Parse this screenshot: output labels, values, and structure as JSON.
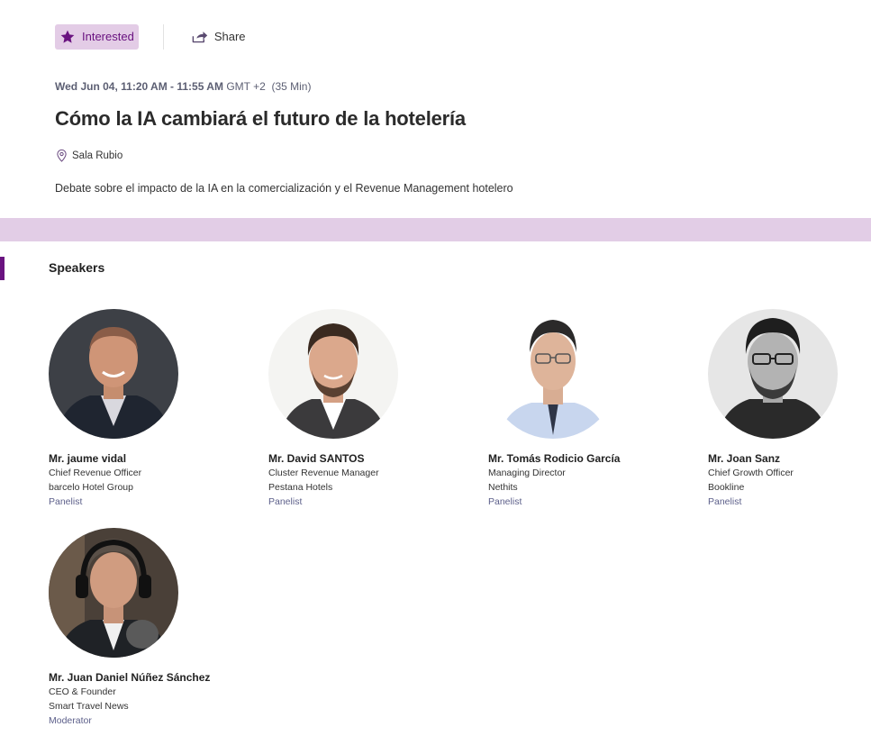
{
  "actions": {
    "interested_label": "Interested",
    "share_label": "Share"
  },
  "session": {
    "datetime": "Wed Jun 04, 11:20 AM - 11:55 AM",
    "timezone": "GMT +2",
    "duration": "(35 Min)",
    "title": "Cómo la IA cambiará el futuro de la hotelería",
    "location": "Sala Rubio",
    "description": "Debate sobre el impacto de la IA en la comercialización y el Revenue Management hotelero"
  },
  "speakers_section": {
    "heading": "Speakers",
    "speakers": [
      {
        "name": "Mr. jaume vidal",
        "title": "Chief Revenue Officer",
        "company": "barcelo Hotel Group",
        "role": "Panelist"
      },
      {
        "name": "Mr. David SANTOS",
        "title": "Cluster Revenue Manager",
        "company": "Pestana Hotels",
        "role": "Panelist"
      },
      {
        "name": "Mr. Tomás Rodicio García",
        "title": "Managing Director",
        "company": "Nethits",
        "role": "Panelist"
      },
      {
        "name": "Mr. Joan Sanz",
        "title": "Chief Growth Officer",
        "company": "Bookline",
        "role": "Panelist"
      },
      {
        "name": "Mr. Juan Daniel Núñez Sánchez",
        "title": "CEO & Founder",
        "company": "Smart Travel News",
        "role": "Moderator"
      }
    ]
  },
  "colors": {
    "accent": "#6a1380",
    "accent_light": "#e3cce6",
    "band": "#e2cde6"
  }
}
